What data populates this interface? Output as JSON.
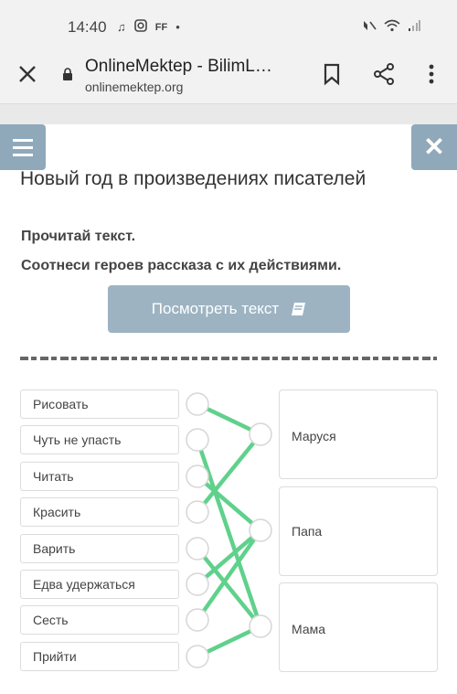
{
  "status_bar": {
    "time": "14:40",
    "left_icons": [
      "music-note-icon",
      "instagram-icon",
      "ff-icon",
      "dot-icon"
    ],
    "ff_label": "FF",
    "right_icons": [
      "mute-icon",
      "wifi-icon",
      "signal-icon"
    ]
  },
  "browser": {
    "title": "OnlineMektep - BilimL…",
    "url": "onlinemektep.org"
  },
  "page": {
    "title": "Новый год в произведениях писателей",
    "instruction_1": "Прочитай текст.",
    "instruction_2": "Соотнеси героев рассказа с их действиями.",
    "view_text_button": "Посмотреть текст"
  },
  "matching": {
    "actions": [
      "Рисовать",
      "Чуть не упасть",
      "Читать",
      "Красить",
      "Варить",
      "Едва удержаться",
      "Сесть",
      "Прийти"
    ],
    "characters": [
      "Маруся",
      "Папа",
      "Мама"
    ],
    "connections": [
      {
        "action": "Рисовать",
        "character": "Маруся"
      },
      {
        "action": "Чуть не упасть",
        "character": "Мама"
      },
      {
        "action": "Читать",
        "character": "Папа"
      },
      {
        "action": "Красить",
        "character": "Маруся"
      },
      {
        "action": "Варить",
        "character": "Мама"
      },
      {
        "action": "Едва удержаться",
        "character": "Папа"
      },
      {
        "action": "Сесть",
        "character": "Папа"
      },
      {
        "action": "Прийти",
        "character": "Мама"
      }
    ],
    "line_color": "#5fd18b"
  }
}
